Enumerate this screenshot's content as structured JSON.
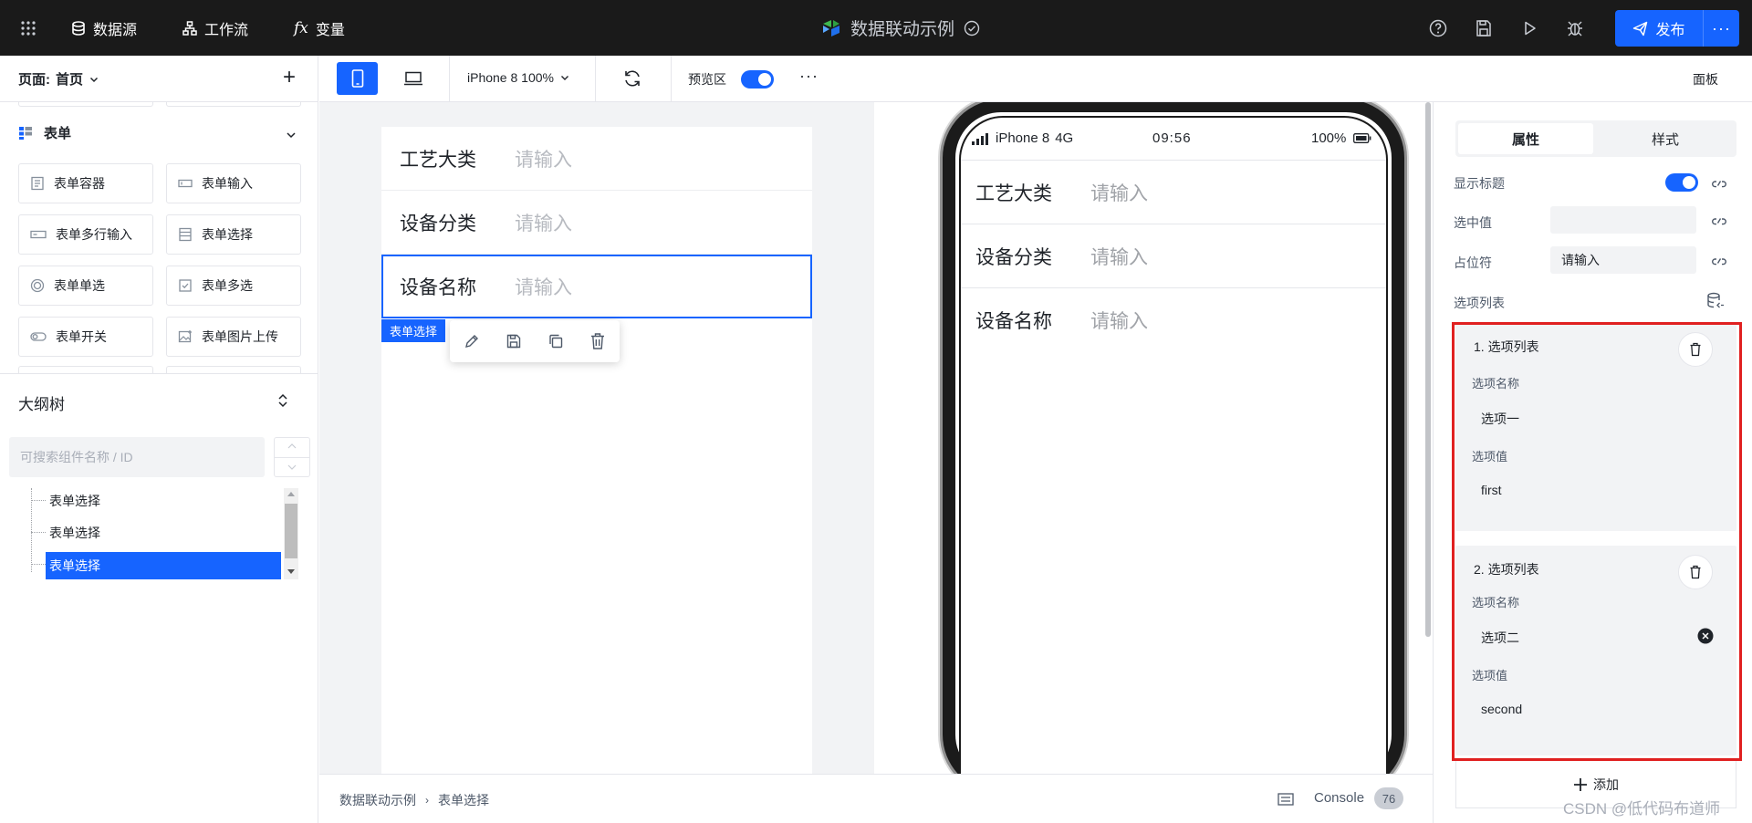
{
  "topbar": {
    "nav": {
      "datasource": "数据源",
      "workflow": "工作流",
      "variable": "变量"
    },
    "app_title": "数据联动示例",
    "publish_label": "发布",
    "more_label": "···"
  },
  "left": {
    "page_prefix": "页面:",
    "page_name": "首页",
    "add_label": "+",
    "section_title": "表单",
    "components": [
      "表单容器",
      "表单输入",
      "表单多行输入",
      "表单选择",
      "表单单选",
      "表单多选",
      "表单开关",
      "表单图片上传"
    ],
    "outline_title": "大纲树",
    "search_placeholder": "可搜索组件名称 / ID",
    "tree_items": [
      "表单选择",
      "表单选择",
      "表单选择"
    ]
  },
  "toolbar": {
    "device": "iPhone 8 100%",
    "preview_label": "预览区",
    "more": "···",
    "panel_label": "面板"
  },
  "canvas": {
    "rows": [
      {
        "label": "工艺大类",
        "placeholder": "请输入"
      },
      {
        "label": "设备分类",
        "placeholder": "请输入"
      },
      {
        "label": "设备名称",
        "placeholder": "请输入"
      }
    ],
    "selected_tag": "表单选择"
  },
  "phone": {
    "carrier": "iPhone 8",
    "network": "4G",
    "time": "09:56",
    "battery": "100%"
  },
  "bottombar": {
    "breadcrumb": [
      "数据联动示例",
      "表单选择"
    ],
    "console_label": "Console",
    "console_count": "76"
  },
  "right": {
    "tabs": [
      "属性",
      "样式"
    ],
    "props": {
      "show_title": "显示标题",
      "selected_value": "选中值",
      "placeholder_label": "占位符",
      "placeholder_value": "请输入",
      "option_list": "选项列表"
    },
    "options": [
      {
        "title": "1. 选项列表",
        "name_label": "选项名称",
        "name": "选项一",
        "value_label": "选项值",
        "value": "first"
      },
      {
        "title": "2. 选项列表",
        "name_label": "选项名称",
        "name": "选项二",
        "value_label": "选项值",
        "value": "second"
      }
    ],
    "add_label": "添加"
  },
  "watermark": "CSDN @低代码布道师",
  "colors": {
    "accent": "#1664ff",
    "highlight": "#e02020",
    "topbar": "#1a1a1a"
  }
}
